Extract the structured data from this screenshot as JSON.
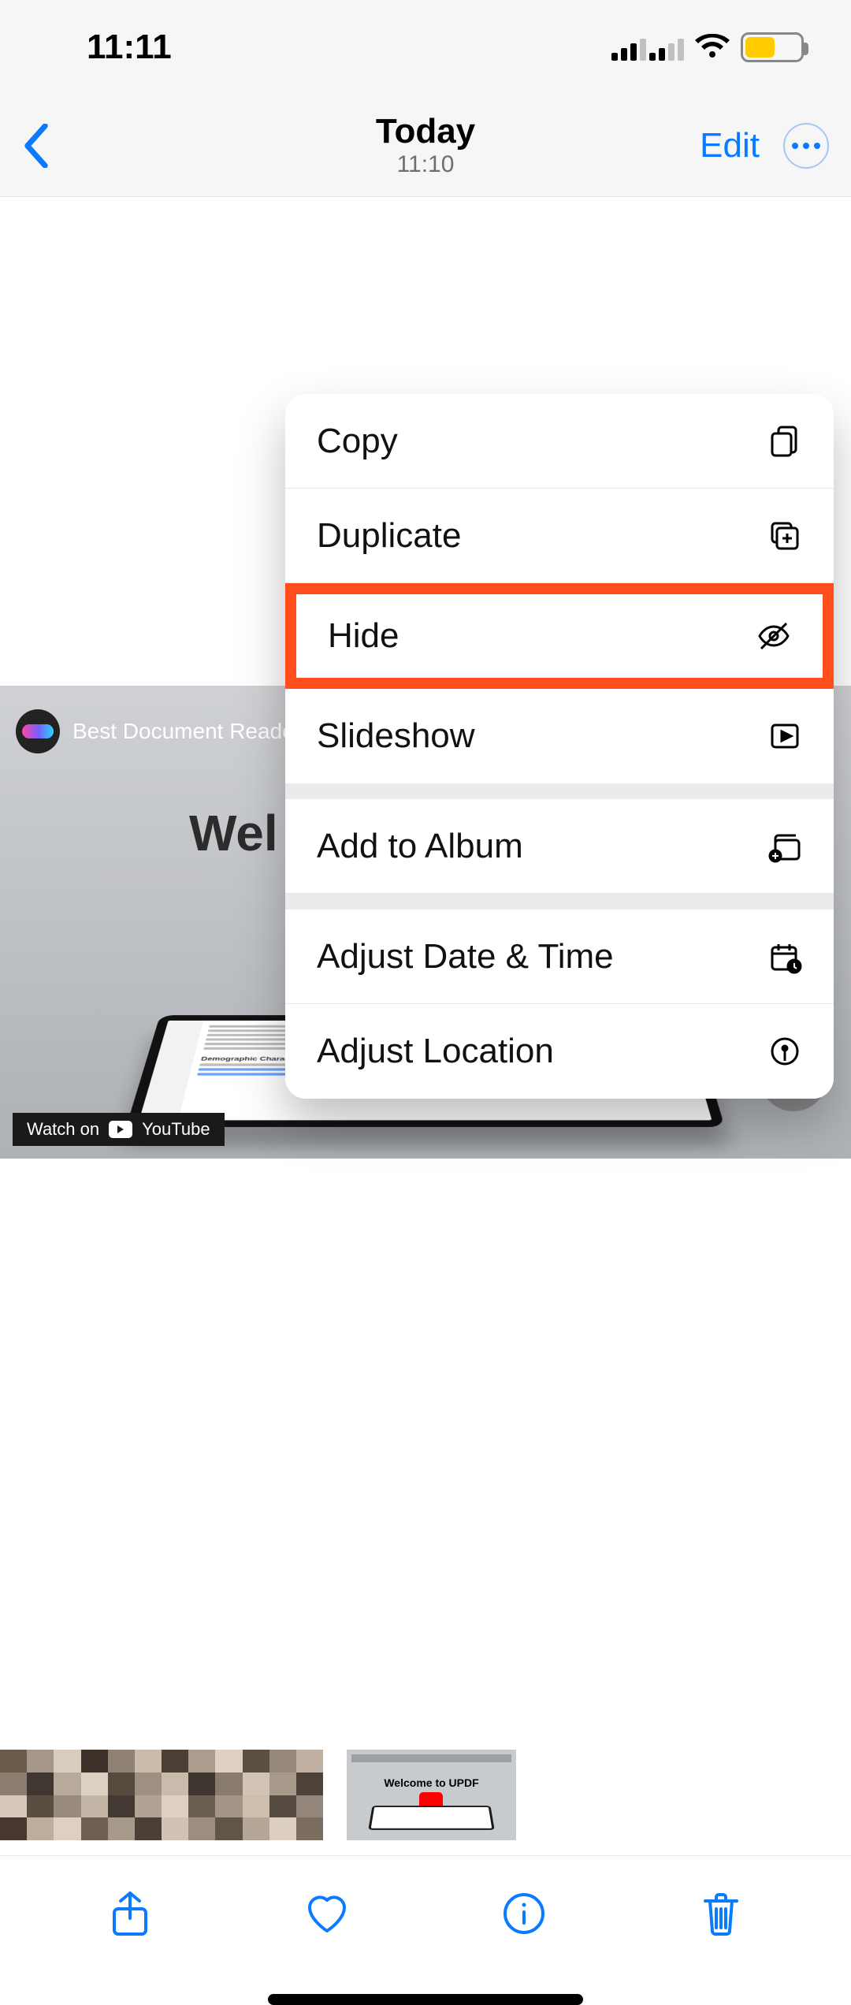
{
  "status": {
    "time": "11:11",
    "battery_level": 0.5,
    "battery_color": "#ffcc00"
  },
  "nav": {
    "title": "Today",
    "subtitle": "11:10",
    "edit": "Edit"
  },
  "menu": {
    "copy": "Copy",
    "duplicate": "Duplicate",
    "hide": "Hide",
    "slideshow": "Slideshow",
    "add_to_album": "Add to Album",
    "adjust_date_time": "Adjust Date & Time",
    "adjust_location": "Adjust Location"
  },
  "video": {
    "caption": "Best Document Reade",
    "heading_partial": "Wel",
    "watch_on": "Watch on",
    "watch_on_brand": "YouTube",
    "article_heading": "Demographic Characteristics"
  },
  "filmstrip": {
    "mini_title": "Welcome to UPDF"
  },
  "highlight": {
    "target": "hide",
    "color": "#ff4e1c"
  }
}
